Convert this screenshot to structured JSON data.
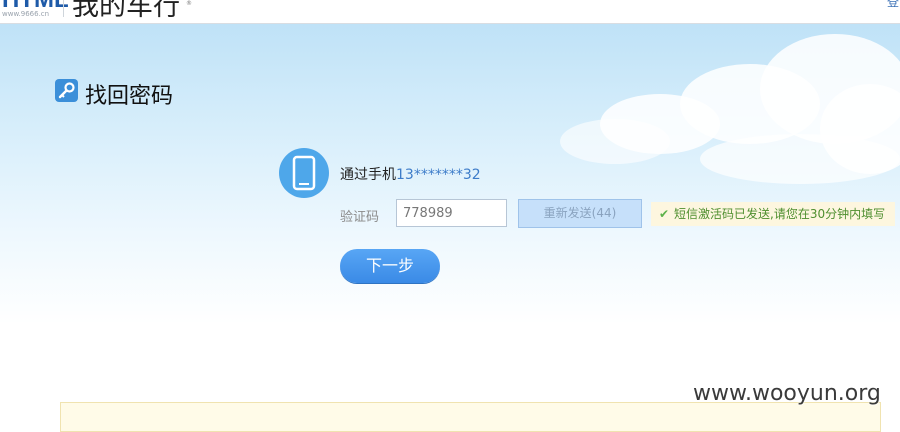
{
  "header": {
    "logo_text": "HTML",
    "logo_url": "www.9666.cn",
    "site_title": "我的车行",
    "site_title_mark": "®",
    "right_link": "登"
  },
  "page": {
    "heading": "找回密码"
  },
  "verify": {
    "method_label": "通过手机",
    "phone_masked": "13*******32",
    "code_label": "验证码",
    "code_value": "778989",
    "resend_label": "重新发送(44)",
    "tip_text": "短信激活码已发送,请您在30分钟内填写"
  },
  "actions": {
    "next_label": "下一步"
  },
  "watermark": "www.wooyun.org",
  "colors": {
    "accent": "#3a8ae6",
    "phone_number": "#3d7cc9",
    "tip_text": "#4f8f2f"
  },
  "icons": {
    "heading": "key-icon",
    "phone": "mobile-phone-icon",
    "tip": "check-icon"
  }
}
